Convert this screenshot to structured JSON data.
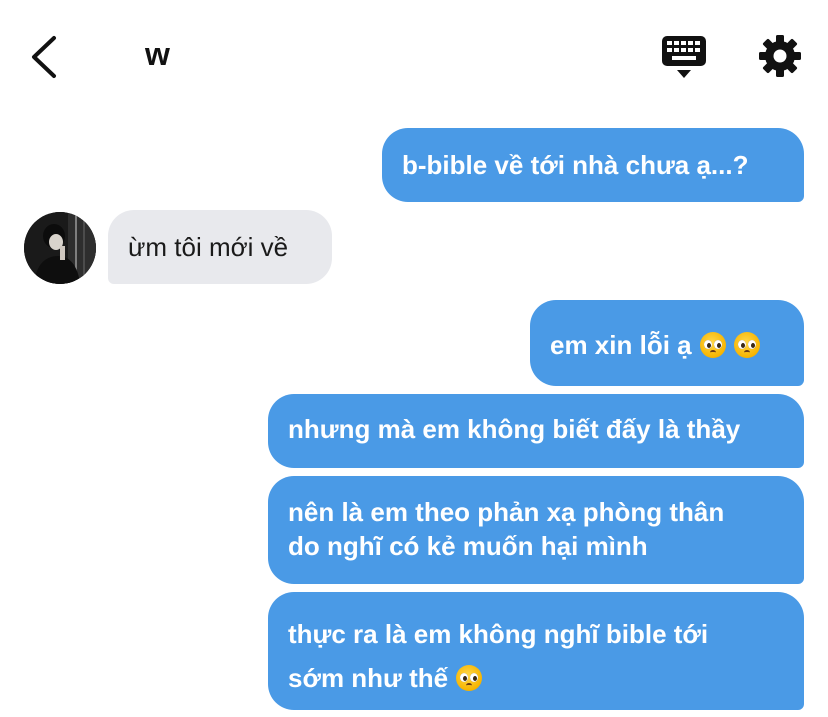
{
  "header": {
    "title": "w",
    "back_icon": "chevron-left-icon",
    "keyboard_icon": "keyboard-icon",
    "settings_icon": "gear-icon"
  },
  "messages": [
    {
      "from": "me",
      "text": "b-bible về tới nhà chưa ạ...?"
    },
    {
      "from": "them",
      "text": "ừm tôi mới về"
    },
    {
      "from": "me",
      "text": "em xin lỗi ạ",
      "emoji": [
        "pleading-face",
        "pleading-face"
      ]
    },
    {
      "from": "me",
      "text": "nhưng mà em không biết đấy là thầy"
    },
    {
      "from": "me",
      "line1": "nên là em theo phản xạ phòng thân",
      "line2": "do nghĩ có kẻ muốn hại mình"
    },
    {
      "from": "me",
      "line1": "thực ra là em không nghĩ bible tới",
      "line2": "sớm như thế",
      "emoji": [
        "pleading-face"
      ]
    }
  ],
  "colors": {
    "sent_bubble": "#4a9ae6",
    "received_bubble": "#e8e9ed",
    "sent_text": "#ffffff",
    "received_text": "#1a1a1a"
  }
}
